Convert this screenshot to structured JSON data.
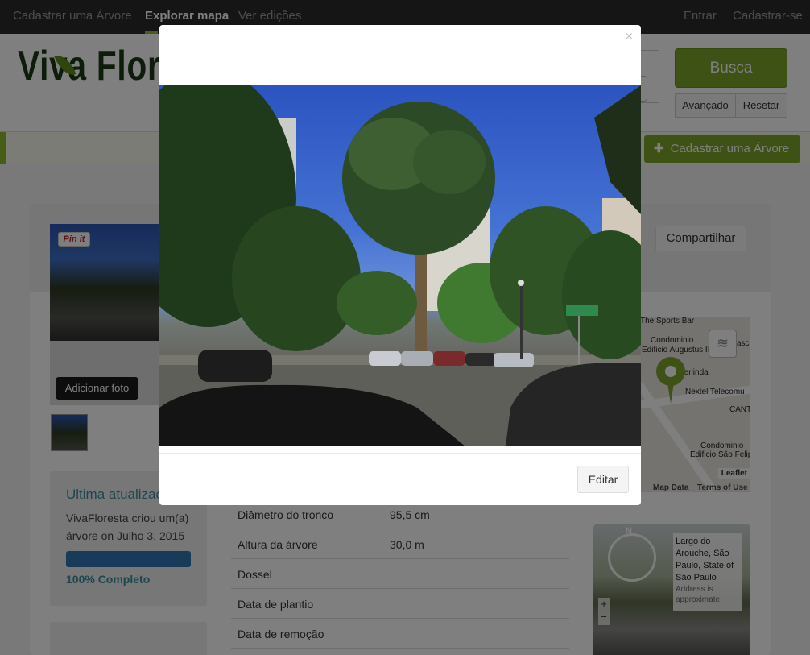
{
  "nav": {
    "left": [
      "Cadastrar uma Árvore",
      "Explorar mapa",
      "Ver edições"
    ],
    "right": [
      "Entrar",
      "Cadastrar-se"
    ]
  },
  "header": {
    "logo_text": "Viva Flor",
    "search_button": "Busca",
    "advanced_button": "Avançado",
    "reset_button": "Resetar",
    "add_tree_button": "Cadastrar uma Árvore"
  },
  "tree": {
    "pinit_label": "Pin it",
    "add_photo_button": "Adicionar foto",
    "share_button": "Compartilhar"
  },
  "update": {
    "title": "Ultima atualização",
    "text": "VivaFloresta criou um(a) árvore on Julho 3, 2015",
    "progress_percent": 100,
    "progress_label": "100% Completo"
  },
  "details": [
    {
      "label": "Diâmetro do tronco",
      "value": "95,5 cm"
    },
    {
      "label": "Altura da árvore",
      "value": "30,0 m"
    },
    {
      "label": "Dossel",
      "value": ""
    },
    {
      "label": "Data de plantio",
      "value": ""
    },
    {
      "label": "Data de remoção",
      "value": ""
    }
  ],
  "map": {
    "labels": [
      "The Sports Bar",
      "Condominio",
      "Edificio Augustus II",
      "Berlinda",
      "Nextel Telecomu",
      "CANT",
      "Condominio",
      "Edificio São Felip",
      "asc"
    ],
    "leaflet": "Leaflet",
    "map_data": "Map Data",
    "terms": "Terms of Use"
  },
  "streetview": {
    "compass": "N",
    "address": "Largo do Arouche, São Paulo, State of São Paulo",
    "address_note": "Address is approximate"
  },
  "modal": {
    "close": "×",
    "edit_button": "Editar"
  }
}
